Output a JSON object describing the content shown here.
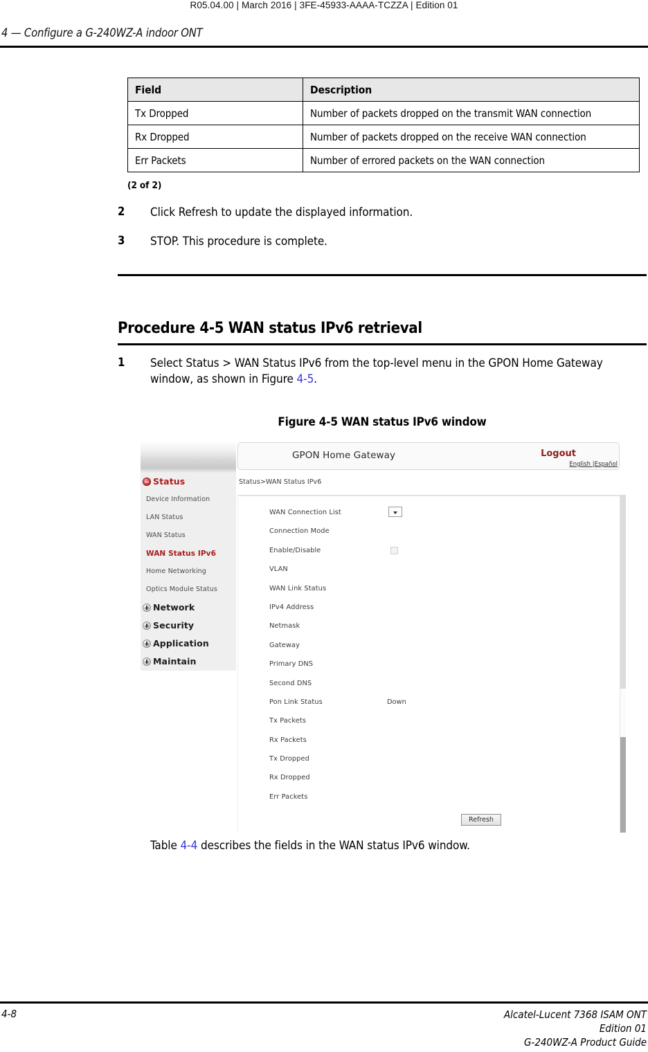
{
  "header": {
    "doc_id": "R05.04.00 | March 2016 | 3FE-45933-AAAA-TCZZA | Edition 01",
    "chapter": "4 —  Configure a G-240WZ-A indoor ONT"
  },
  "field_table": {
    "headers": [
      "Field",
      "Description"
    ],
    "rows": [
      [
        "Tx Dropped",
        "Number of packets dropped on the transmit WAN connection"
      ],
      [
        "Rx Dropped",
        "Number of packets dropped on the receive WAN connection"
      ],
      [
        "Err Packets",
        "Number of errored packets on the WAN connection"
      ]
    ],
    "note": "(2 of 2)"
  },
  "steps_prev": [
    {
      "num": "2",
      "text": "Click Refresh to update the displayed information."
    },
    {
      "num": "3",
      "text": "STOP. This procedure is complete."
    }
  ],
  "procedure": {
    "title": "Procedure 4-5  WAN status IPv6 retrieval",
    "step1_num": "1",
    "step1_part1": "Select Status > WAN Status IPv6 from the top-level menu in the GPON Home Gateway window, as shown in Figure ",
    "step1_xref": "4-5",
    "step1_part2": "."
  },
  "figure": {
    "caption": "Figure 4-5  WAN status IPv6 window",
    "window": {
      "brand": "GPON Home Gateway",
      "logout": "Logout",
      "lang_en": "English",
      "lang_sep": " |",
      "lang_es": "Español",
      "breadcrumb": "Status>WAN Status IPv6",
      "refresh": "Refresh"
    },
    "nav": [
      {
        "label": "Status",
        "type": "group-open",
        "icon": "minus-expander-icon"
      },
      {
        "label": "Device Information",
        "type": "item"
      },
      {
        "label": "LAN Status",
        "type": "item"
      },
      {
        "label": "WAN Status",
        "type": "item"
      },
      {
        "label": "WAN Status IPv6",
        "type": "active"
      },
      {
        "label": "Home Networking",
        "type": "item"
      },
      {
        "label": "Optics Module Status",
        "type": "item"
      },
      {
        "label": "Network",
        "type": "group",
        "icon": "plus-expander-icon"
      },
      {
        "label": "Security",
        "type": "group",
        "icon": "plus-expander-icon"
      },
      {
        "label": "Application",
        "type": "group",
        "icon": "plus-expander-icon"
      },
      {
        "label": "Maintain",
        "type": "group",
        "icon": "plus-expander-icon"
      }
    ],
    "fields": [
      {
        "label": "WAN Connection List",
        "value": "",
        "control": "dropdown"
      },
      {
        "label": "Connection Mode",
        "value": "",
        "control": "none"
      },
      {
        "label": "Enable/Disable",
        "value": "",
        "control": "checkbox"
      },
      {
        "label": "VLAN",
        "value": "",
        "control": "none"
      },
      {
        "label": "WAN Link Status",
        "value": "",
        "control": "none"
      },
      {
        "label": "IPv4 Address",
        "value": "",
        "control": "none"
      },
      {
        "label": "Netmask",
        "value": "",
        "control": "none"
      },
      {
        "label": "Gateway",
        "value": "",
        "control": "none"
      },
      {
        "label": "Primary DNS",
        "value": "",
        "control": "none"
      },
      {
        "label": "Second DNS",
        "value": "",
        "control": "none"
      },
      {
        "label": "Pon Link Status",
        "value": "Down",
        "control": "none"
      },
      {
        "label": "Tx Packets",
        "value": "",
        "control": "none"
      },
      {
        "label": "Rx Packets",
        "value": "",
        "control": "none"
      },
      {
        "label": "Tx Dropped",
        "value": "",
        "control": "none"
      },
      {
        "label": "Rx Dropped",
        "value": "",
        "control": "none"
      },
      {
        "label": "Err Packets",
        "value": "",
        "control": "none"
      }
    ]
  },
  "trailing": {
    "part1": "Table ",
    "xref": "4-4",
    "part2": " describes the fields in the WAN status IPv6 window."
  },
  "footer": {
    "page": "4-8",
    "line1": "Alcatel-Lucent 7368 ISAM ONT",
    "line2": "Edition 01",
    "line3": "G-240WZ-A Product Guide"
  }
}
